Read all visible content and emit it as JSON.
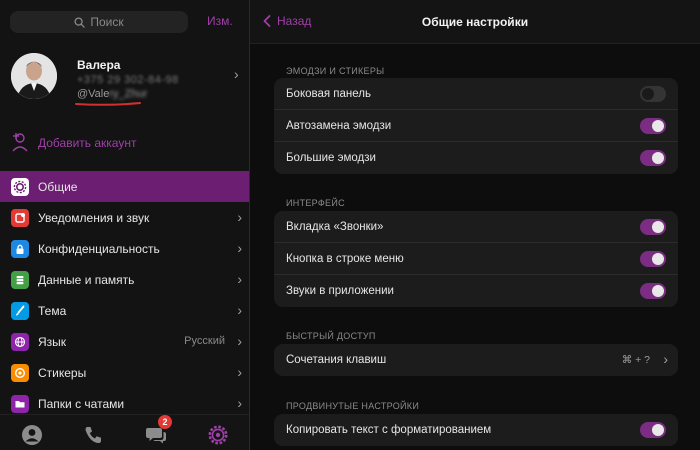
{
  "sidebar": {
    "search_placeholder": "Поиск",
    "edit_label": "Изм.",
    "profile": {
      "name": "Валера",
      "phone": "+375 29 302-84-98",
      "username_visible": "@Vale",
      "username_hidden": "ry_Zhur"
    },
    "add_account_label": "Добавить аккаунт",
    "menu": [
      {
        "label": "Общие",
        "icon": "gear-icon",
        "color": "#ffffff",
        "active": true
      },
      {
        "label": "Уведомления и звук",
        "icon": "bell-icon",
        "color": "#e53935"
      },
      {
        "label": "Конфиденциальность",
        "icon": "lock-icon",
        "color": "#1e88e5"
      },
      {
        "label": "Данные и память",
        "icon": "database-icon",
        "color": "#43a047"
      },
      {
        "label": "Тема",
        "icon": "brush-icon",
        "color": "#039be5"
      },
      {
        "label": "Язык",
        "icon": "globe-icon",
        "color": "#8e24aa",
        "value": "Русский"
      },
      {
        "label": "Стикеры",
        "icon": "sticker-icon",
        "color": "#fb8c00"
      },
      {
        "label": "Папки с чатами",
        "icon": "folder-icon",
        "color": "#8e24aa"
      }
    ],
    "tabbar": {
      "chats_badge": "2"
    }
  },
  "main": {
    "back_label": "Назад",
    "title": "Общие настройки",
    "sections": [
      {
        "title": "ЭМОДЗИ И СТИКЕРЫ",
        "rows": [
          {
            "label": "Боковая панель",
            "toggle": false
          },
          {
            "label": "Автозамена эмодзи",
            "toggle": true
          },
          {
            "label": "Большие эмодзи",
            "toggle": true
          }
        ]
      },
      {
        "title": "ИНТЕРФЕЙС",
        "rows": [
          {
            "label": "Вкладка «Звонки»",
            "toggle": true
          },
          {
            "label": "Кнопка в строке меню",
            "toggle": true
          },
          {
            "label": "Звуки в приложении",
            "toggle": true
          }
        ]
      },
      {
        "title": "БЫСТРЫЙ ДОСТУП",
        "rows": [
          {
            "label": "Сочетания клавиш",
            "hint": "⌘ + ?"
          }
        ]
      },
      {
        "title": "ПРОДВИНУТЫЕ НАСТРОЙКИ",
        "rows": [
          {
            "label": "Копировать текст с форматированием",
            "toggle": true
          }
        ]
      }
    ]
  },
  "colors": {
    "accent": "#9f3fa8",
    "active_bg": "#6c1f72",
    "toggle_on": "#7a2d82",
    "badge": "#e53935"
  }
}
